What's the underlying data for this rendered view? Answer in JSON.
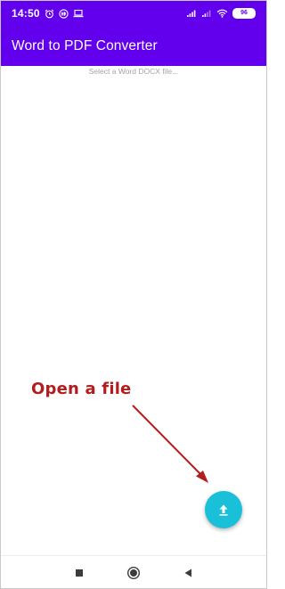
{
  "status_bar": {
    "time": "14:50",
    "notification_icons": [
      "alarm-icon",
      "hd-icon",
      "laptop-icon"
    ],
    "system_icons": [
      "signal-icon",
      "signal-icon",
      "wifi-icon"
    ],
    "battery_level": "96"
  },
  "app_bar": {
    "title": "Word to PDF Converter",
    "background_color": "#6200ee"
  },
  "content": {
    "hint": "Select a Word DOCX file..."
  },
  "annotation": {
    "text": "Open a file",
    "color": "#b21d1d"
  },
  "fab": {
    "icon": "upload-icon",
    "color": "#19c0d8"
  },
  "nav_bar": {
    "buttons": [
      "recents-icon",
      "home-icon",
      "back-icon"
    ]
  }
}
